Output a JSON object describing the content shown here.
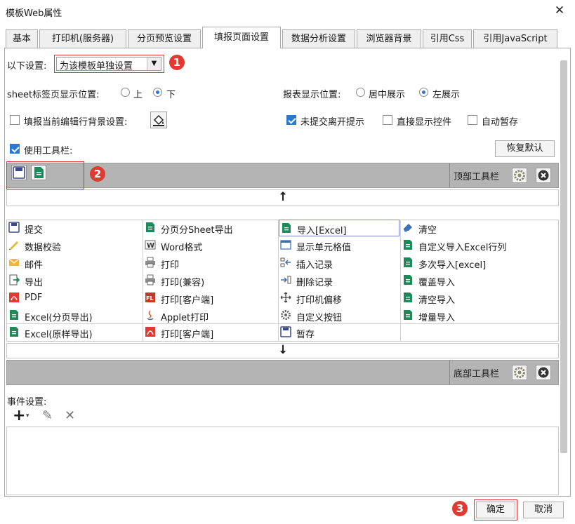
{
  "window": {
    "title": "模板Web属性",
    "close": "✕"
  },
  "tabs": [
    {
      "label": "基本"
    },
    {
      "label": "打印机(服务器)"
    },
    {
      "label": "分页预览设置"
    },
    {
      "label": "填报页面设置"
    },
    {
      "label": "数据分析设置"
    },
    {
      "label": "浏览器背景"
    },
    {
      "label": "引用Css"
    },
    {
      "label": "引用JavaScript"
    }
  ],
  "settings": {
    "scope_label": "以下设置:",
    "scope_value": "为该模板单独设置",
    "sheet_label": "sheet标签页显示位置:",
    "sheet_top": "上",
    "sheet_bottom": "下",
    "report_label": "报表显示位置:",
    "report_center": "居中展示",
    "report_left": "左展示",
    "fill_bg_label": "填报当前编辑行背景设置:",
    "leave_prompt": "未提交离开提示",
    "direct_show": "直接显示控件",
    "auto_save": "自动暂存",
    "use_toolbar": "使用工具栏:",
    "restore_default": "恢复默认"
  },
  "toolbar": {
    "top_label": "顶部工具栏",
    "bottom_label": "底部工具栏",
    "up_arrow": "↑",
    "down_arrow": "↓"
  },
  "buttons": {
    "col1": [
      "提交",
      "数据校验",
      "邮件",
      "导出",
      "PDF",
      "Excel(分页导出)",
      "Excel(原样导出)"
    ],
    "col2": [
      "分页分Sheet导出",
      "Word格式",
      "打印",
      "打印(兼容)",
      "打印[客户端]",
      "Applet打印",
      "打印[客户端]"
    ],
    "col3": [
      "导入[Excel]",
      "显示单元格值",
      "插入记录",
      "删除记录",
      "打印机偏移",
      "自定义按钮",
      "暂存"
    ],
    "col4": [
      "清空",
      "自定义导入Excel行列",
      "多次导入[excel]",
      "覆盖导入",
      "清空导入",
      "增量导入"
    ]
  },
  "events": {
    "label": "事件设置:",
    "add": "+",
    "add_caret": "▾",
    "edit": "✎",
    "delete": "✕"
  },
  "footer": {
    "ok": "确定",
    "cancel": "取消"
  },
  "badges": [
    "1",
    "2",
    "3"
  ],
  "colors": {
    "accent": "#2a78d6",
    "annotation": "#e03a32",
    "bar": "#b4b4b4"
  }
}
